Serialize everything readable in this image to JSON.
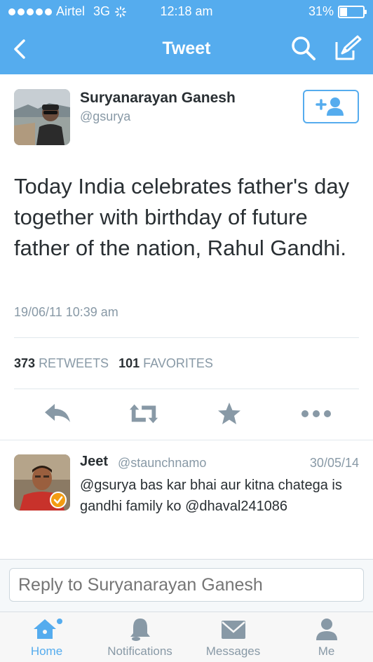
{
  "status_bar": {
    "carrier": "Airtel",
    "network": "3G",
    "time": "12:18 am",
    "battery": "31%",
    "battery_level": 0.31
  },
  "nav": {
    "title": "Tweet",
    "back_icon": "chevron-left-icon",
    "search_icon": "search-icon",
    "compose_icon": "compose-icon"
  },
  "tweet": {
    "author_name": "Suryanarayan Ganesh",
    "author_handle": "@gsurya",
    "text": "Today India celebrates father's day together with birthday of future father of the nation, Rahul Gandhi.",
    "timestamp": "19/06/11 10:39 am",
    "retweets_count": "373",
    "retweets_label": "RETWEETS",
    "favorites_count": "101",
    "favorites_label": "FAVORITES"
  },
  "reply": {
    "name": "Jeet",
    "handle": "@staunchnamo",
    "date": "30/05/14",
    "text": "@gsurya bas kar bhai aur kitna chatega is gandhi family ko @dhaval241086"
  },
  "compose": {
    "placeholder": "Reply to Suryanarayan Ganesh"
  },
  "tabs": [
    {
      "label": "Home",
      "icon": "home-icon",
      "active": true
    },
    {
      "label": "Notifications",
      "icon": "bell-icon",
      "active": false
    },
    {
      "label": "Messages",
      "icon": "envelope-icon",
      "active": false
    },
    {
      "label": "Me",
      "icon": "person-icon",
      "active": false
    }
  ],
  "colors": {
    "brand": "#55acee",
    "text": "#292f33",
    "secondary": "#8899a6",
    "action_icon": "#8899a6"
  }
}
